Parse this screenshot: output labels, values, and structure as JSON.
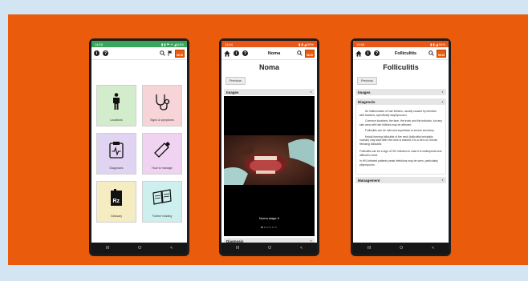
{
  "phone1": {
    "status_left": "14:05",
    "status_right": "▮ ▮ ⚑ ✈ ◢ 63%",
    "tiles": [
      {
        "label": "Locations"
      },
      {
        "label": "Signs & symptoms"
      },
      {
        "label": "Diagnoses"
      },
      {
        "label": "How to manage"
      },
      {
        "label": "Glossary"
      },
      {
        "label": "Further reading"
      }
    ],
    "glossary_glyph": "Rz"
  },
  "phone2": {
    "status_left": "13:44",
    "status_right": "▮ ▮ ◢ 59%",
    "header_title": "Noma",
    "page_title": "Noma",
    "prev_label": "Previous",
    "section_images": "Images",
    "caption": "Noma stage 0",
    "dots": "●○○○○○",
    "section_diagnosis": "Diagnosis"
  },
  "phone3": {
    "status_left": "13:45",
    "status_right": "▮ ▮ ◢ 54%",
    "header_title": "Folliculitis",
    "page_title": "Folliculitis",
    "prev_label": "Previous",
    "section_images": "Images",
    "section_diagnosis": "Diagnosis",
    "diag_p1": "An inflammation of hair follicles, usually caused by infection with bacteria, specifically staphylococci",
    "diag_p2": "Common locations: the face, the trunk and the buttocks, but any skin area with hair follicles may be affected",
    "diag_p3": "Folliculitis can be mild and superficial or severe and deep",
    "diag_p4": "Keloid-forming folliculitis of the neck (folliculitis keloidalis nuchae) may start after the neck is shaved; it is a form of chronic fibrosing folliculitis",
    "diag_p5": "Folliculitis can be a sign of HIV infection in case it is widespread and difficult to treat.",
    "diag_p6": "In HIV-infected patients yeast infections may be seen, particularly pityrosporon.",
    "section_management": "Management"
  },
  "navbar": {
    "recent": "III",
    "home": "O",
    "back": "<"
  },
  "logo_text": "NLSI",
  "colors": {
    "brand_orange": "#ea5b0c",
    "status_green": "#3aa55d",
    "background_light": "#d3e4f3"
  }
}
